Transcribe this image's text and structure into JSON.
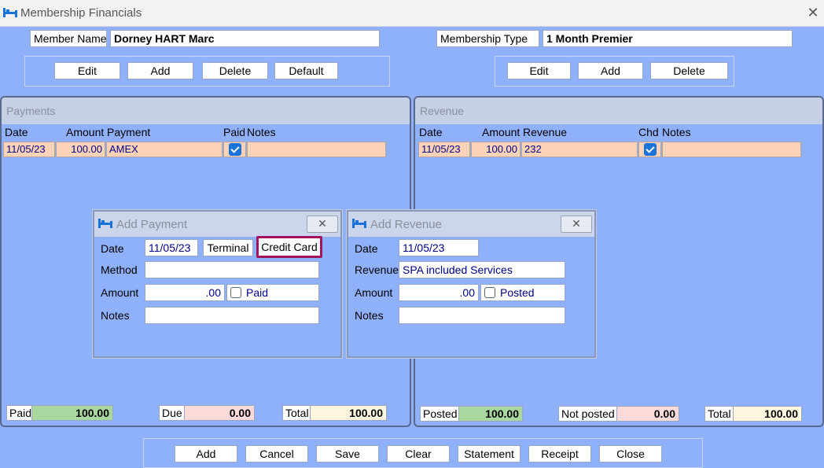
{
  "window": {
    "title": "Membership Financials"
  },
  "member": {
    "name_label": "Member Name",
    "name_value": "Dorney HART Marc"
  },
  "membership": {
    "type_label": "Membership Type",
    "type_value": "1 Month Premier"
  },
  "member_buttons": {
    "edit": "Edit",
    "add": "Add",
    "delete": "Delete",
    "default": "Default"
  },
  "membership_buttons": {
    "edit": "Edit",
    "add": "Add",
    "delete": "Delete"
  },
  "payments": {
    "title": "Payments",
    "columns": {
      "date": "Date",
      "amount": "Amount",
      "payment": "Payment",
      "paid": "Paid",
      "notes": "Notes"
    },
    "rows": [
      {
        "date": "11/05/23",
        "amount": "100.00",
        "payment": "AMEX",
        "paid": true,
        "notes": ""
      }
    ],
    "totals": {
      "paid_label": "Paid",
      "paid_value": "100.00",
      "due_label": "Due",
      "due_value": "0.00",
      "total_label": "Total",
      "total_value": "100.00"
    }
  },
  "revenue": {
    "title": "Revenue",
    "columns": {
      "date": "Date",
      "amount": "Amount",
      "revenue": "Revenue",
      "chd": "Chd",
      "notes": "Notes"
    },
    "rows": [
      {
        "date": "11/05/23",
        "amount": "100.00",
        "revenue": "232",
        "chd": true,
        "notes": ""
      }
    ],
    "totals": {
      "posted_label": "Posted",
      "posted_value": "100.00",
      "notposted_label": "Not posted",
      "notposted_value": "0.00",
      "total_label": "Total",
      "total_value": "100.00"
    }
  },
  "add_payment": {
    "title": "Add Payment",
    "date_label": "Date",
    "date_value": "11/05/23",
    "terminal_label": "Terminal",
    "creditcard_label": "Credit Card",
    "method_label": "Method",
    "method_value": "",
    "amount_label": "Amount",
    "amount_value": ".00",
    "paid_label": "Paid",
    "notes_label": "Notes",
    "notes_value": ""
  },
  "add_revenue": {
    "title": "Add Revenue",
    "date_label": "Date",
    "date_value": "11/05/23",
    "revenue_label": "Revenue",
    "revenue_value": "SPA included Services",
    "amount_label": "Amount",
    "amount_value": ".00",
    "posted_label": "Posted",
    "notes_label": "Notes",
    "notes_value": ""
  },
  "bottom_buttons": {
    "add": "Add",
    "cancel": "Cancel",
    "save": "Save",
    "clear": "Clear",
    "statement": "Statement",
    "receipt": "Receipt",
    "close": "Close"
  },
  "icons": {
    "app": "bed-icon",
    "close": "close-icon"
  },
  "colors": {
    "background": "#8fb0fb",
    "row": "#fcd3b6",
    "checkbox": "#1a73d9",
    "highlight": "#a3125c"
  }
}
